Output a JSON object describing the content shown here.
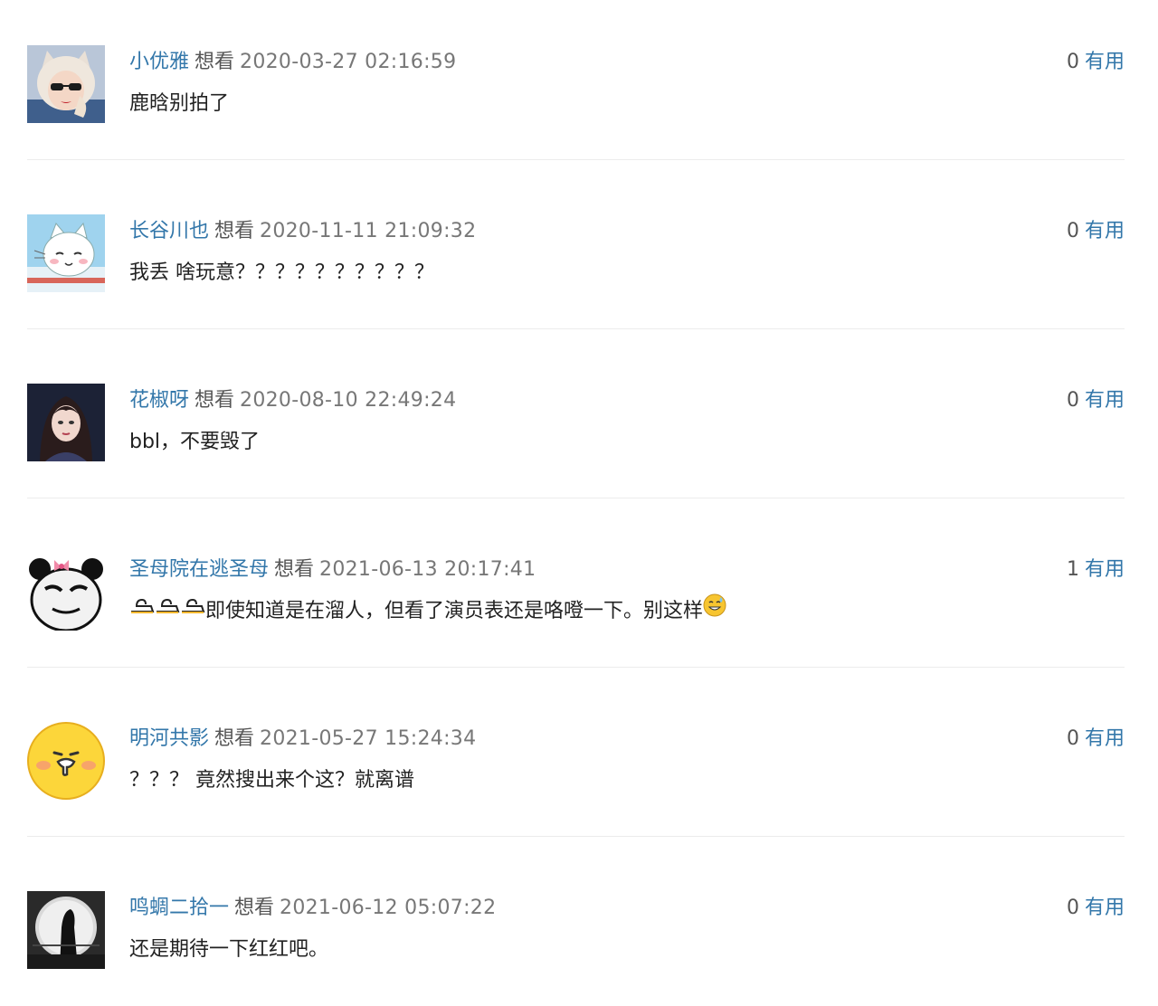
{
  "comments": [
    {
      "username": "小优雅",
      "rating": "想看",
      "time": "2020-03-27 02:16:59",
      "useful_count": "0",
      "useful_label": "有用",
      "content": "鹿晗别拍了",
      "avatar_icon": "girl-in-cat-hood-avatar-icon"
    },
    {
      "username": "长谷川也",
      "rating": "想看",
      "time": "2020-11-11 21:09:32",
      "useful_count": "0",
      "useful_label": "有用",
      "content": "我丢 啥玩意？？？？？？？？？？",
      "avatar_icon": "cartoon-cat-avatar-icon"
    },
    {
      "username": "花椒呀",
      "rating": "想看",
      "time": "2020-08-10 22:49:24",
      "useful_count": "0",
      "useful_label": "有用",
      "content": "bbl，不要毁了",
      "avatar_icon": "woman-portrait-avatar-icon"
    },
    {
      "username": "圣母院在逃圣母",
      "rating": "想看",
      "time": "2021-06-13 20:17:41",
      "useful_count": "1",
      "useful_label": "有用",
      "content": "即使知道是在溜人，但看了演员表还是咯噔一下。别这样",
      "avatar_icon": "panda-meme-avatar-icon"
    },
    {
      "username": "明河共影",
      "rating": "想看",
      "time": "2021-05-27 15:24:34",
      "useful_count": "0",
      "useful_label": "有用",
      "content": "？？？ 竟然搜出来个这？就离谱",
      "avatar_icon": "yellow-emoji-avatar-icon"
    },
    {
      "username": "鸣蜩二拾一",
      "rating": "想看",
      "time": "2021-06-12 05:07:22",
      "useful_count": "0",
      "useful_label": "有用",
      "content": "还是期待一下红红吧。",
      "avatar_icon": "dark-silhouette-avatar-icon"
    }
  ]
}
